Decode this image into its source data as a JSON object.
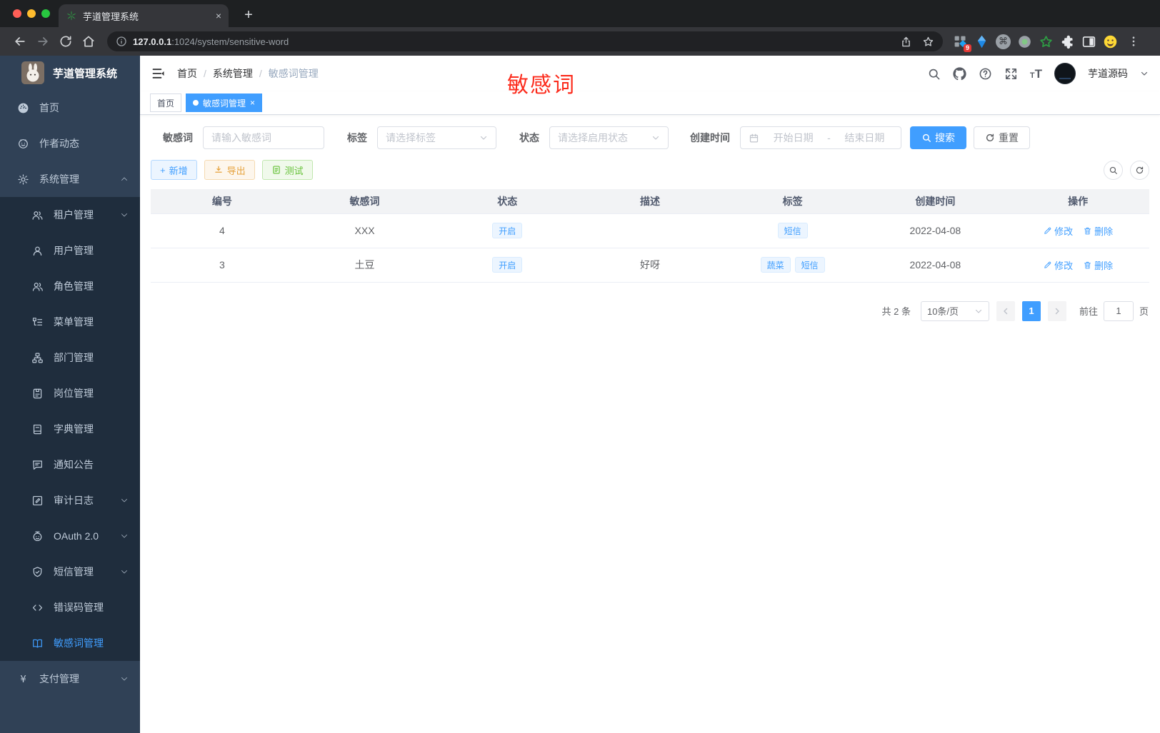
{
  "browser": {
    "tab_title": "芋道管理系统",
    "url_host": "127.0.0.1",
    "url_rest": ":1024/system/sensitive-word",
    "extension_badge": "9",
    "cmd_glyph": "⌘",
    "new_tab_label": "+",
    "close_tab_label": "×"
  },
  "sidebar": {
    "title": "芋道管理系统",
    "items": [
      {
        "key": "home",
        "label": "首页",
        "icon": "dashboard-icon",
        "level": 1
      },
      {
        "key": "author-news",
        "label": "作者动态",
        "icon": "face-chat-icon",
        "level": 1
      },
      {
        "key": "system",
        "label": "系统管理",
        "icon": "gear-icon",
        "level": 1,
        "arrow": "up"
      },
      {
        "key": "tenant",
        "label": "租户管理",
        "icon": "users-icon",
        "level": 2,
        "arrow": "down"
      },
      {
        "key": "user",
        "label": "用户管理",
        "icon": "user-icon",
        "level": 2
      },
      {
        "key": "role",
        "label": "角色管理",
        "icon": "roles-icon",
        "level": 2
      },
      {
        "key": "menu",
        "label": "菜单管理",
        "icon": "menu-tree-icon",
        "level": 2
      },
      {
        "key": "dept",
        "label": "部门管理",
        "icon": "org-icon",
        "level": 2
      },
      {
        "key": "post",
        "label": "岗位管理",
        "icon": "badge-icon",
        "level": 2
      },
      {
        "key": "dict",
        "label": "字典管理",
        "icon": "dict-icon",
        "level": 2
      },
      {
        "key": "notice",
        "label": "通知公告",
        "icon": "notice-icon",
        "level": 2
      },
      {
        "key": "audit-log",
        "label": "审计日志",
        "icon": "log-icon",
        "level": 2,
        "arrow": "down"
      },
      {
        "key": "oauth",
        "label": "OAuth 2.0",
        "icon": "robot-icon",
        "level": 2,
        "arrow": "down"
      },
      {
        "key": "sms",
        "label": "短信管理",
        "icon": "shield-icon",
        "level": 2,
        "arrow": "down"
      },
      {
        "key": "error-code",
        "label": "错误码管理",
        "icon": "code-icon",
        "level": 2
      },
      {
        "key": "sensitive-word",
        "label": "敏感词管理",
        "icon": "open-book-icon",
        "level": 2,
        "active": true
      },
      {
        "key": "pay",
        "label": "支付管理",
        "icon": "yen-icon",
        "level": 1,
        "arrow": "down"
      }
    ]
  },
  "header": {
    "breadcrumb": [
      "首页",
      "系统管理",
      "敏感词管理"
    ],
    "separator": "/",
    "username": "芋道源码"
  },
  "annotation": {
    "text": "敏感词",
    "color": "#fc2b1c"
  },
  "tags_view": {
    "tabs": [
      {
        "label": "首页",
        "active": false
      },
      {
        "label": "敏感词管理",
        "active": true,
        "closable": true
      }
    ],
    "close_glyph": "×"
  },
  "filters": {
    "keyword": {
      "label": "敏感词",
      "placeholder": "请输入敏感词"
    },
    "tag": {
      "label": "标签",
      "placeholder": "请选择标签"
    },
    "status": {
      "label": "状态",
      "placeholder": "请选择启用状态"
    },
    "create_time": {
      "label": "创建时间",
      "start_placeholder": "开始日期",
      "separator": "-",
      "end_placeholder": "结束日期"
    },
    "search_label": "搜索",
    "reset_label": "重置"
  },
  "toolbar": {
    "add_label": "新增",
    "add_plus": "+",
    "export_label": "导出",
    "test_label": "测试"
  },
  "table": {
    "columns": [
      "编号",
      "敏感词",
      "状态",
      "描述",
      "标签",
      "创建时间",
      "操作"
    ],
    "rows": [
      {
        "id": "4",
        "word": "XXX",
        "status": "开启",
        "description": "",
        "tags": [
          "短信"
        ],
        "create_time": "2022-04-08"
      },
      {
        "id": "3",
        "word": "土豆",
        "status": "开启",
        "description": "好呀",
        "tags": [
          "蔬菜",
          "短信"
        ],
        "create_time": "2022-04-08"
      }
    ],
    "actions": {
      "edit": "修改",
      "delete": "删除"
    }
  },
  "pagination": {
    "total_text": "共 2 条",
    "page_size": "10条/页",
    "current_page": "1",
    "goto_label": "前往",
    "goto_value": "1",
    "page_suffix": "页"
  },
  "colors": {
    "accent": "#409eff",
    "warning": "#e6a23c",
    "success": "#67c23a",
    "sidebar_bg": "#304156",
    "submenu_bg": "#1f2d3d",
    "annotation_red": "#fc2b1c"
  }
}
